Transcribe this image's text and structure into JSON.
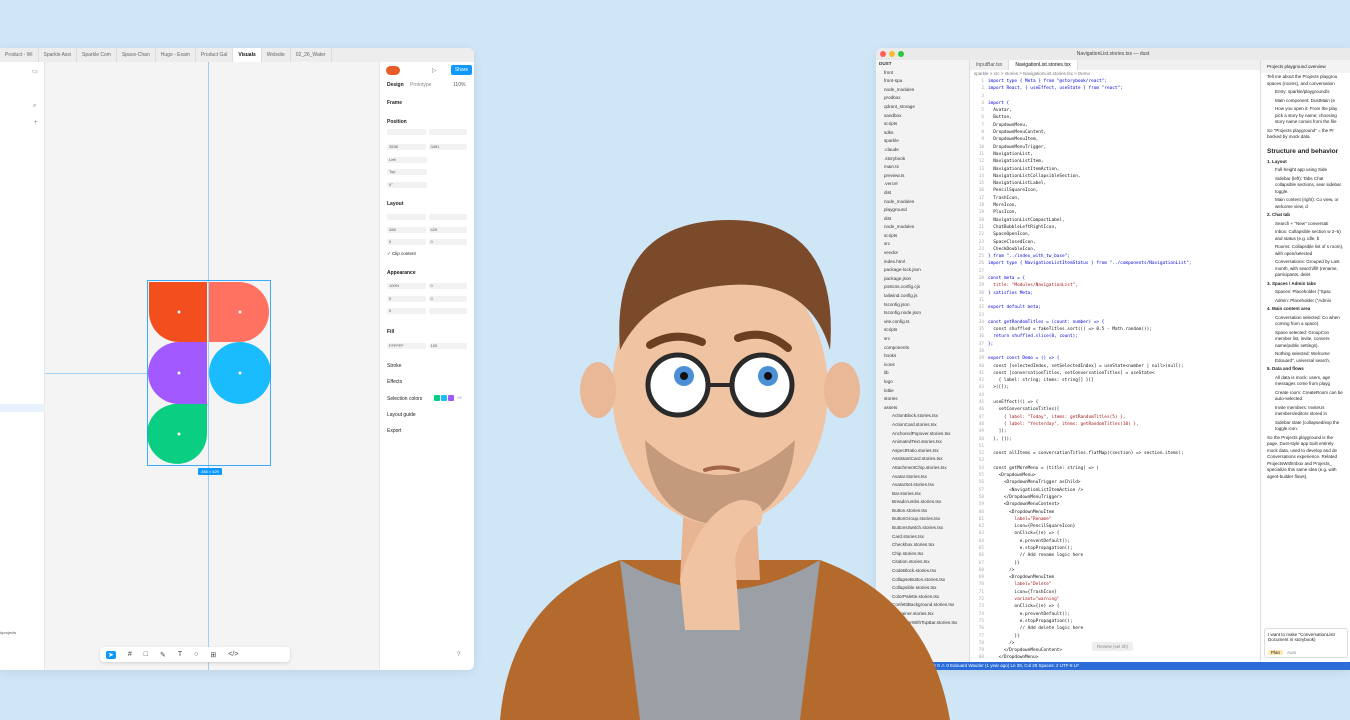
{
  "figma": {
    "tabs": [
      "Product - Wi",
      "Sparkle Assi",
      "Sparkle Com",
      "Space-Chan",
      "Hugo - Exam",
      "Product Gal",
      "Visuals",
      "Website",
      "02_26_Water"
    ],
    "active_tab": "Visuals",
    "share": "Share",
    "design_tab": "Design",
    "prototype_tab": "Prototype",
    "zoom": "110%",
    "frame": "Frame",
    "position": "Position",
    "x": "3538",
    "y": "3451",
    "left": "Left",
    "top": "Top",
    "rotation": "0°",
    "layout": "Layout",
    "w": "288",
    "h": "429",
    "gap1": "0",
    "gap2": "0",
    "clip": "Clip content",
    "appearance": "Appearance",
    "opacity": "100%",
    "radius1": "0",
    "radius2": "0",
    "radius3": "0",
    "radius4": "0",
    "fill": "Fill",
    "fill_hex": "FFFFFF",
    "fill_pct": "100",
    "stroke": "Stroke",
    "effects": "Effects",
    "selection_colors": "Selection colors",
    "sel_more": "+2",
    "layout_guide": "Layout guide",
    "export": "Export",
    "size_badge": "288 × 429",
    "left_text": "#projects",
    "help": "?"
  },
  "editor": {
    "title": "NavigationList.stories.tsx — dust",
    "tabs": [
      "InputBar.tsx",
      "NavigationList.stories.tsx"
    ],
    "breadcrumb": "sparkle > src > stories > NavigationList.stories.tsx > Demo",
    "explorer": [
      "DUST",
      "front",
      "front-spa",
      "node_modules",
      "prodbox",
      "qdrant_storage",
      "sandbox",
      "scripts",
      "sdks",
      "sparkle",
      ".claude",
      ".storybook",
      "main.ts",
      "preview.ts",
      ".vercel",
      "dist",
      "node_modules",
      "playground",
      "dist",
      "node_modules",
      "scripts",
      "src",
      "vendor",
      "index.html",
      "package-lock.json",
      "package.json",
      "postcss.config.cjs",
      "tailwind.config.js",
      "tsconfig.json",
      "tsconfig.node.json",
      "vite.config.ts",
      "scripts",
      "src",
      "components",
      "hooks",
      "icons",
      "lib",
      "logo",
      "lottie",
      "stories",
      "assets",
      "ActionBlock.stories.tsx",
      "ActionCard.stories.tsx",
      "AnchoredPopover.stories.tsx",
      "AnimatedText.stories.tsx",
      "AspectRatio.stories.tsx",
      "AssistantCard.stories.tsx",
      "AttachmentChip.stories.tsx",
      "Avatar.stories.tsx",
      "AvatarSet.stories.tsx",
      "Bar.stories.tsx",
      "Breadcrumbs.stories.tsx",
      "Button.stories.tsx",
      "ButtonGroup.stories.tsx",
      "ButtonsSwitch.stories.tsx",
      "Card.stories.tsx",
      "Checkbox.stories.tsx",
      "Chip.stories.tsx",
      "Citation.stories.tsx",
      "CodeBlock.stories.tsx",
      "CollapseButton.stories.tsx",
      "Collapsible.stories.tsx",
      "ColorPalette.stories.tsx",
      "ConfettiBackground.stories.tsx",
      "Container.stories.tsx",
      "ContainerWithTopBar.stories.tsx",
      "OUTLINE",
      "TIMELINE"
    ],
    "code": [
      "import type { Meta } from \"@storybook/react\";",
      "import React, { useEffect, useState } from \"react\";",
      "",
      "import {",
      "  Avatar,",
      "  Button,",
      "  DropdownMenu,",
      "  DropdownMenuContent,",
      "  DropdownMenuItem,",
      "  DropdownMenuTrigger,",
      "  NavigationList,",
      "  NavigationListItem,",
      "  NavigationListItemAction,",
      "  NavigationListCollapsibleSection,",
      "  NavigationListLabel,",
      "  PencilSquareIcon,",
      "  TrashIcon,",
      "  MoreIcon,",
      "  PlusIcon,",
      "  NavigationListCompactLabel,",
      "  ChatBubbleLeftRightIcon,",
      "  SpaceOpenIcon,",
      "  SpaceClosedIcon,",
      "  CheckDoubleIcon,",
      "} from \"../index_with_tw_base\";",
      "import type { NavigationListItemStatus } from \"../components/NavigationList\";",
      "",
      "const meta = {",
      "  title: \"Modules/NavigationList\",",
      "} satisfies Meta;",
      "",
      "export default meta;",
      "",
      "const getRandomTitles = (count: number) => {",
      "  const shuffled = fakeTitles.sort(() => 0.5 - Math.random());",
      "  return shuffled.slice(0, count);",
      "};",
      "",
      "export const Demo = () => {",
      "  const [selectedIndex, setSelectedIndex] = useState<number | null>(null);",
      "  const [conversationTitles, setConversationTitles] = useState<",
      "    { label: string; items: string[] }[]",
      "  >([]);",
      "",
      "  useEffect(() => {",
      "    setConversationTitles([",
      "      { label: \"Today\", items: getRandomTitles(5) },",
      "      { label: \"Yesterday\", items: getRandomTitles(10) },",
      "    ]);",
      "  }, []);",
      "",
      "  const allItems = conversationTitles.flatMap((section) => section.items);",
      "",
      "  const getMoreMenu = (title: string) => (",
      "    <DropdownMenu>",
      "      <DropdownMenuTrigger asChild>",
      "        <NavigationListItemAction />",
      "      </DropdownMenuTrigger>",
      "      <DropdownMenuContent>",
      "        <DropdownMenuItem",
      "          label=\"Rename\"",
      "          icon={PencilSquareIcon}",
      "          onClick={(e) => {",
      "            e.preventDefault();",
      "            e.stopPropagation();",
      "            // Add rename logic here",
      "          }}",
      "        />",
      "        <DropdownMenuItem",
      "          label=\"Delete\"",
      "          icon={TrashIcon}",
      "          variant=\"warning\"",
      "          onClick={(e) => {",
      "            e.preventDefault();",
      "            e.stopPropagation();",
      "            // Add delete logic here",
      "          }}",
      "        />",
      "      </DropdownMenuContent>",
      "    </DropdownMenu>",
      "  );"
    ],
    "chat_header": "Projects playground overview",
    "chat_intro": "Tell me about the Projects playgrou spaces (rooms), and conversation",
    "chat_bullets": [
      "Entry: sparkle/playground/s",
      "Main component: DustMain (e",
      "How you open it: From the play pick a story by name; choosing story name comes from the file"
    ],
    "chat_p2": "So \"Projects playground\" = the Pr backed by mock data.",
    "chat_h1": "Structure and behavior",
    "chat_s1": "1. Layout",
    "chat_l1": [
      "Full-height app using Side",
      "Sidebar (left): Tabs Chat collapsible sections, sear sidebar toggle.",
      "Main content (right): Co view, or welcome view, d"
    ],
    "chat_s2": "2. Chat tab",
    "chat_l2": [
      "Search + \"New\" conversati",
      "Inbox: Collapsible section w 2–5) and status (e.g. idle, b",
      "Rooms: Collapsible list of s room), with open/selected",
      "Conversations: Grouped by Last month, with search/filt (rename, participants, delet"
    ],
    "chat_s3": "3. Spaces / Admin tabs",
    "chat_l3": [
      "Spaces: Placeholder (\"Spac",
      "Admin: Placeholder (\"Admin"
    ],
    "chat_s4": "4. Main content area",
    "chat_l4": [
      "Conversation selected: Co when coming from a space)",
      "Space selected: GroupCon member list, invite, convers name/public settings).",
      "Nothing selected: Welcome Edouard\", universal search,"
    ],
    "chat_s5": "5. Data and flows",
    "chat_l5": [
      "All data is mock: users, age messages come from playg",
      "Create room: CreateRoom can be auto-selected.",
      "Invite members: InviteUs members/editors stored in",
      "Sidebar state (collapsed/exp the toggle icon."
    ],
    "chat_p3": "So the Projects playground is the page, Dust-style app built entirely mock data, used to develop and de Conversations experience. Related ProjectsWithInbox and Projects_ specialize this same idea (e.g. with agent-builder flows).",
    "chat_input": "I want to make \"ConversationListI Document in storybook)",
    "chat_plan": "Plan",
    "chat_auto": "Auto",
    "review_btn": "Review (sel 2h)",
    "status": "sparkle/teamSpinner   dust   ⊘ 0 ⚠ 0   Edouard Wautier (1 year ago)   Ln 39, Col 28   Spaces: 2   UTF-8   LF"
  },
  "colors": {
    "red": "#f24e1e",
    "salmon": "#ff7262",
    "purple": "#a259ff",
    "blue": "#1abcfe",
    "green": "#0acf83",
    "accent": "#0d99ff"
  }
}
